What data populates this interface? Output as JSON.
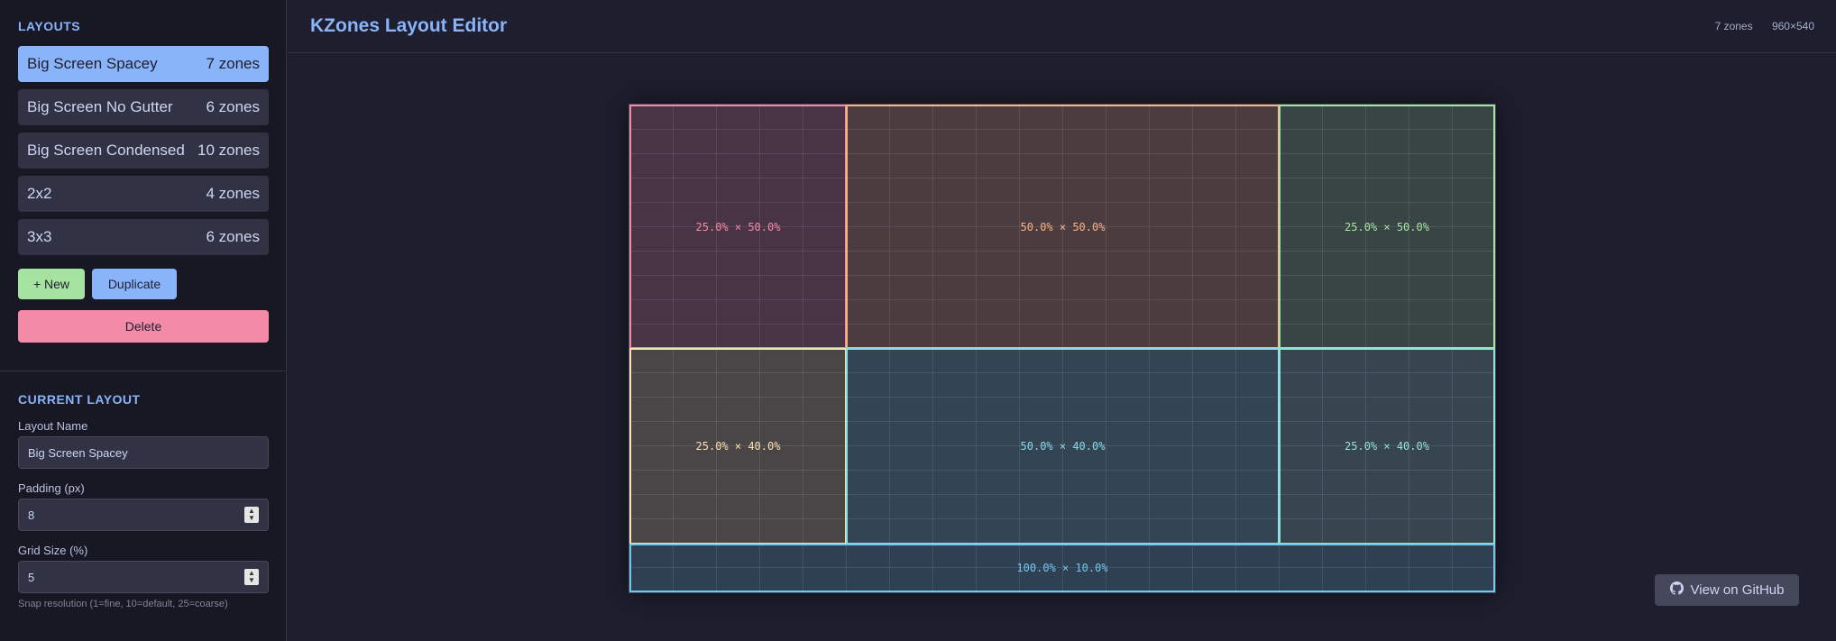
{
  "sidebar": {
    "layouts_title": "LAYOUTS",
    "layouts": [
      {
        "name": "Big Screen Spacey",
        "zones": "7 zones"
      },
      {
        "name": "Big Screen No Gutter",
        "zones": "6 zones"
      },
      {
        "name": "Big Screen Condensed",
        "zones": "10 zones"
      },
      {
        "name": "2x2",
        "zones": "4 zones"
      },
      {
        "name": "3x3",
        "zones": "6 zones"
      }
    ],
    "new_label": "+ New",
    "duplicate_label": "Duplicate",
    "delete_label": "Delete",
    "current_title": "CURRENT LAYOUT",
    "layout_name_label": "Layout Name",
    "layout_name_value": "Big Screen Spacey",
    "padding_label": "Padding (px)",
    "padding_value": "8",
    "grid_label": "Grid Size (%)",
    "grid_value": "5",
    "grid_hint": "Snap resolution (1=fine, 10=default, 25=coarse)"
  },
  "header": {
    "title": "KZones Layout Editor",
    "zone_count": "7 zones",
    "resolution": "960×540"
  },
  "zones": [
    {
      "label": "25.0% × 50.0%",
      "color": "#f38ba8"
    },
    {
      "label": "50.0% × 50.0%",
      "color": "#fab387"
    },
    {
      "label": "25.0% × 50.0%",
      "color": "#a6e3a1"
    },
    {
      "label": "25.0% × 40.0%",
      "color": "#f9e2af"
    },
    {
      "label": "50.0% × 40.0%",
      "color": "#89dceb"
    },
    {
      "label": "25.0% × 40.0%",
      "color": "#94e2d5"
    },
    {
      "label": "100.0% × 10.0%",
      "color": "#74c7ec"
    }
  ],
  "github_label": "View on GitHub",
  "icons": {
    "github": "github-icon"
  }
}
